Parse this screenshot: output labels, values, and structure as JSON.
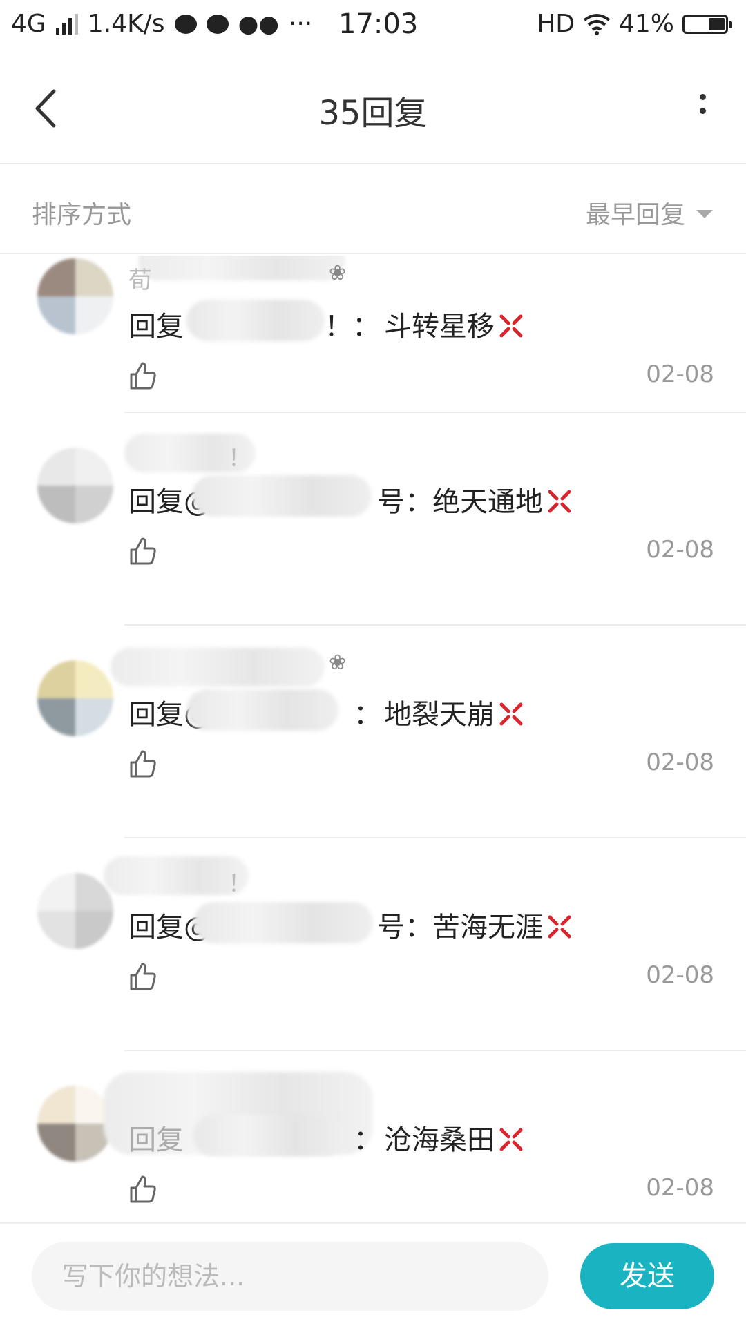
{
  "status_bar": {
    "network": "4G",
    "speed": "1.4K/s",
    "time": "17:03",
    "hd": "HD",
    "battery": "41%",
    "battery_level": 0.41
  },
  "nav": {
    "title": "35回复"
  },
  "sort": {
    "label": "排序方式",
    "selected": "最早回复"
  },
  "replies": [
    {
      "name_tail": "荀",
      "reply_prefix": "回复",
      "reply_tail": "！：",
      "content": "斗转星移",
      "date": "02-08"
    },
    {
      "name_tail": "！",
      "reply_prefix": "回复@",
      "reply_tail": "号：",
      "content": "绝天通地",
      "date": "02-08"
    },
    {
      "name_tail": "",
      "reply_prefix": "回复@",
      "reply_tail": "：",
      "content": "地裂天崩",
      "date": "02-08"
    },
    {
      "name_tail": "！",
      "reply_prefix": "回复@",
      "reply_tail": "号：",
      "content": "苦海无涯",
      "date": "02-08"
    },
    {
      "name_tail": "",
      "reply_prefix": "回复",
      "reply_tail": "：",
      "content": "沧海桑田",
      "date": "02-08"
    }
  ],
  "composer": {
    "placeholder": "写下你的想法...",
    "send_label": "发送"
  }
}
